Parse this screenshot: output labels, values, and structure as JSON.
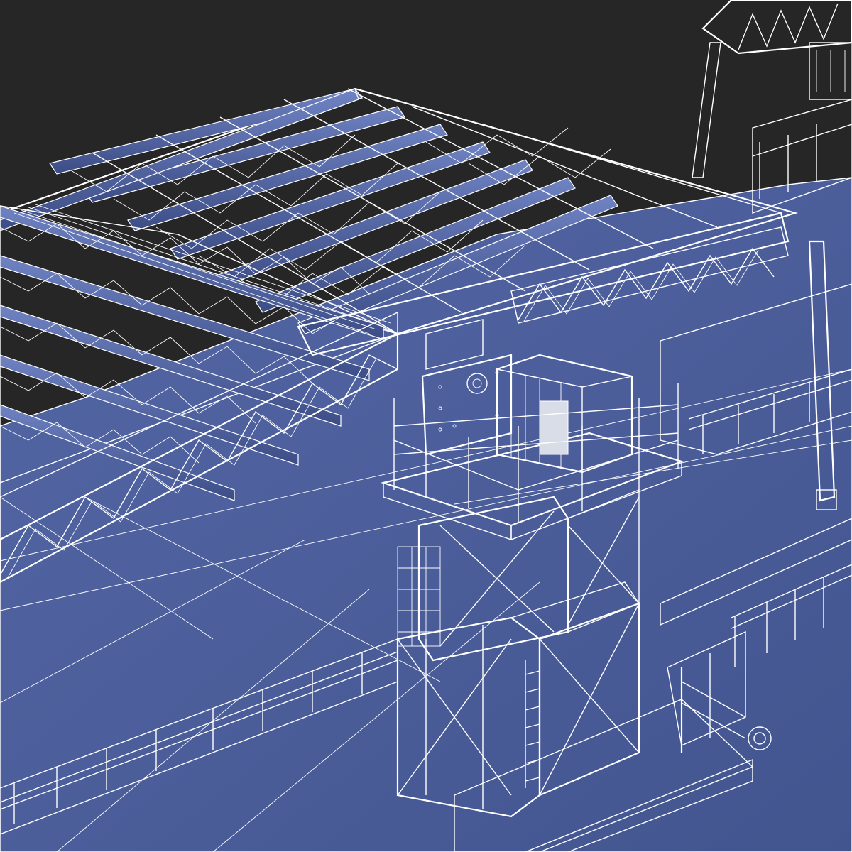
{
  "scene": {
    "background_color": "#262626",
    "mesh_fill_color": "#4b5e9b",
    "mesh_dark_color": "#2f3f73",
    "mesh_light_color": "#6b7fbf",
    "wire_color": "#ffffff"
  }
}
